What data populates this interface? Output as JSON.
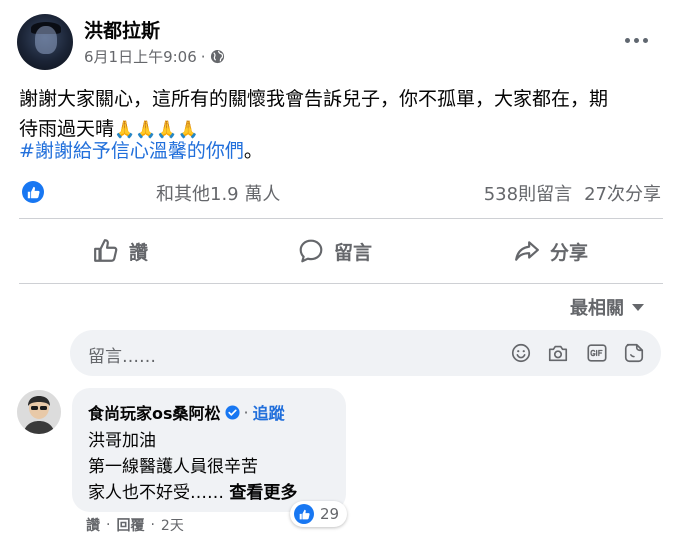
{
  "post": {
    "author": "洪都拉斯",
    "timestamp": "6月1日上午9:06",
    "separator": "·",
    "text_line1": "謝謝大家關心，這所有的關懷我會告訴兒子，你不孤單，大家都在，期",
    "text_line2_prefix": "待雨過天晴",
    "text_line2_emoji": "🙏🙏🙏🙏",
    "hashtag": "#謝謝給予信心溫馨的你們",
    "hashtag_suffix": "。",
    "icons": {
      "audience": "globe-icon",
      "more": "more-options-icon"
    }
  },
  "reactions": {
    "summary": "和其他1.9 萬人",
    "comments_count": "538則留言",
    "shares_count": "27次分享",
    "icon": "like-icon"
  },
  "actions": {
    "like_label": "讚",
    "comment_label": "留言",
    "share_label": "分享"
  },
  "sort": {
    "label": "最相關"
  },
  "composer": {
    "placeholder": "留言……",
    "icons": [
      "emoji-icon",
      "camera-icon",
      "gif-icon",
      "sticker-icon"
    ]
  },
  "comments": [
    {
      "author": "食尚玩家os桑阿松",
      "verified": true,
      "separator": "·",
      "follow_label": "追蹤",
      "line1": "洪哥加油",
      "line2": "第一線醫護人員很辛苦",
      "line3": "家人也不好受……",
      "see_more": "查看更多",
      "reaction_count": "29",
      "like_label": "讚",
      "reply_label": "回覆",
      "time": "2天"
    }
  ],
  "colors": {
    "brand_blue": "#1877f2",
    "link_blue": "#216fdb",
    "secondary_text": "#65676b",
    "bubble_bg": "#f0f2f5"
  }
}
